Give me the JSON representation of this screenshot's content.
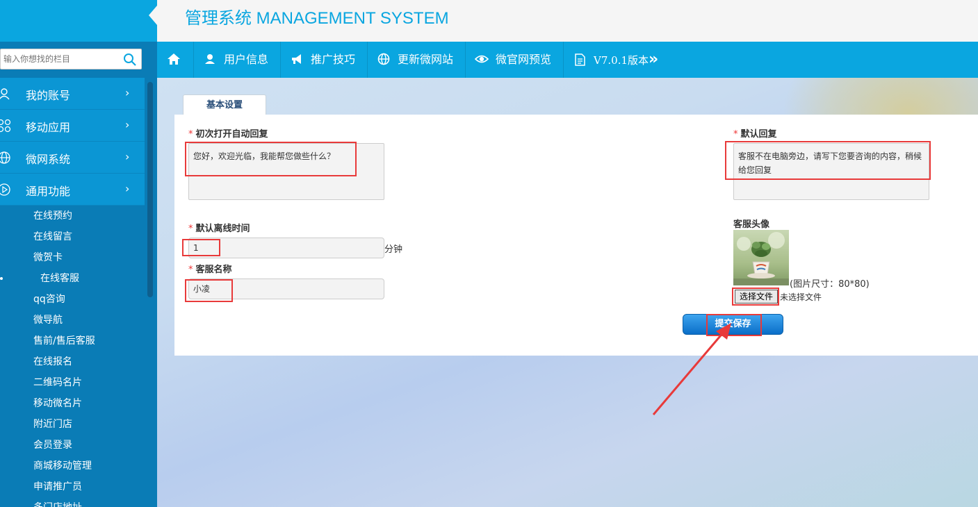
{
  "header": {
    "title": "管理系统 MANAGEMENT SYSTEM"
  },
  "search": {
    "placeholder": "输入你想找的栏目"
  },
  "sidebar": {
    "nav": [
      {
        "label": "我的账号",
        "icon": "user-icon"
      },
      {
        "label": "移动应用",
        "icon": "apps-icon"
      },
      {
        "label": "微网系统",
        "icon": "globe-icon"
      },
      {
        "label": "通用功能",
        "icon": "play-circle-icon"
      }
    ],
    "submenu": [
      "在线预约",
      "在线留言",
      "微贺卡",
      "在线客服",
      "qq咨询",
      "微导航",
      "售前/售后客服",
      "在线报名",
      "二维码名片",
      "移动微名片",
      "附近门店",
      "会员登录",
      "商城移动管理",
      "申请推广员",
      "多门店地址"
    ],
    "active_submenu": "在线客服"
  },
  "topnav": {
    "items": [
      "用户信息",
      "推广技巧",
      "更新微网站",
      "微官网预览",
      "V7.0.1版本"
    ],
    "more": "»"
  },
  "form": {
    "tab": "基本设置",
    "auto_reply_label": "初次打开自动回复",
    "auto_reply_value": "您好，欢迎光临，我能帮您做些什么？",
    "default_reply_label": "默认回复",
    "default_reply_value": "客服不在电脑旁边，请写下您要咨询的内容，稍候给您回复",
    "offline_label": "默认离线时间",
    "offline_value": "1",
    "offline_unit": "分钟",
    "name_label": "客服名称",
    "name_value": "小凌",
    "avatar_label": "客服头像",
    "avatar_size": "(图片尺寸：80*80)",
    "file_button": "选择文件",
    "file_status": "未选择文件",
    "submit": "提交保存",
    "required_mark": "*"
  },
  "colors": {
    "accent": "#0aa6e0",
    "sidebar": "#0a7cb6",
    "highlight": "#e83a3a"
  }
}
